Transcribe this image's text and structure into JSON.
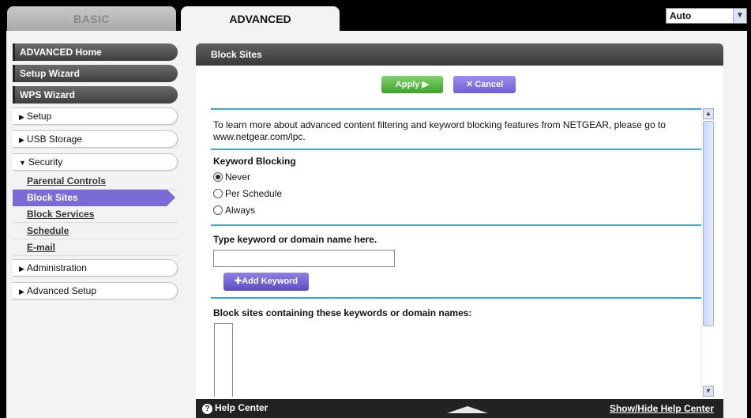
{
  "tabs": {
    "basic": "BASIC",
    "advanced": "ADVANCED"
  },
  "language": {
    "selected": "Auto"
  },
  "sidebar": {
    "advanced_home": "ADVANCED Home",
    "setup_wizard": "Setup Wizard",
    "wps_wizard": "WPS Wizard",
    "setup": "Setup",
    "usb_storage": "USB Storage",
    "security": "Security",
    "security_items": [
      "Parental Controls",
      "Block Sites",
      "Block Services",
      "Schedule",
      "E-mail"
    ],
    "active_item": "Block Sites",
    "administration": "Administration",
    "advanced_setup": "Advanced Setup"
  },
  "panel": {
    "title": "Block Sites",
    "apply": "Apply ▶",
    "cancel": "Cancel",
    "info_text": "To learn more about advanced content filtering and keyword blocking features from NETGEAR, please go to www.netgear.com/lpc.",
    "keyword_blocking": {
      "heading": "Keyword Blocking",
      "options": [
        "Never",
        "Per Schedule",
        "Always"
      ],
      "selected": "Never"
    },
    "keyword_input": {
      "label": "Type keyword or domain name here.",
      "value": ""
    },
    "add_keyword": "Add Keyword",
    "blocked_list_label": "Block sites containing these keywords or domain names:"
  },
  "help": {
    "center": "Help Center",
    "toggle": "Show/Hide Help Center"
  },
  "colors": {
    "accent": "#7a6cd6",
    "apply_green": "#3ea12a",
    "rule_blue": "#38a8d8"
  }
}
